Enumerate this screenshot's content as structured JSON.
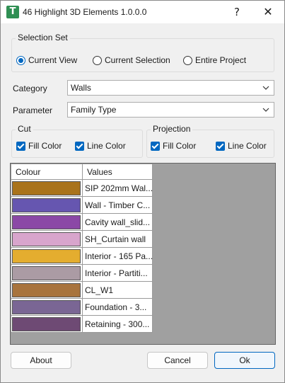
{
  "window": {
    "title": "46 Highlight 3D Elements 1.0.0.0",
    "help_glyph": "?",
    "close_glyph": "✕",
    "icon_glyph": "T"
  },
  "selection_set": {
    "label": "Selection Set",
    "options": [
      "Current View",
      "Current Selection",
      "Entire Project"
    ],
    "selected": "Current View"
  },
  "category": {
    "label": "Category",
    "value": "Walls"
  },
  "parameter": {
    "label": "Parameter",
    "value": "Family Type"
  },
  "cut": {
    "label": "Cut",
    "fill_color": {
      "label": "Fill Color",
      "checked": true
    },
    "line_color": {
      "label": "Line Color",
      "checked": true
    }
  },
  "projection": {
    "label": "Projection",
    "fill_color": {
      "label": "Fill Color",
      "checked": true
    },
    "line_color": {
      "label": "Line Color",
      "checked": true
    }
  },
  "table": {
    "headers": [
      "Colour",
      "Values"
    ],
    "rows": [
      {
        "color": "#a9731b",
        "value": "SIP 202mm Wal..."
      },
      {
        "color": "#6656b0",
        "value": "Wall - Timber C..."
      },
      {
        "color": "#8b48a6",
        "value": "Cavity wall_slid..."
      },
      {
        "color": "#d8a5cc",
        "value": "SH_Curtain wall"
      },
      {
        "color": "#e4ad2f",
        "value": "Interior - 165 Pa..."
      },
      {
        "color": "#ab9ba4",
        "value": "Interior - Partiti..."
      },
      {
        "color": "#a8743d",
        "value": "CL_W1"
      },
      {
        "color": "#7a6694",
        "value": "Foundation - 3..."
      },
      {
        "color": "#6e4a74",
        "value": "Retaining - 300..."
      }
    ]
  },
  "buttons": {
    "about": "About",
    "cancel": "Cancel",
    "ok": "Ok"
  }
}
